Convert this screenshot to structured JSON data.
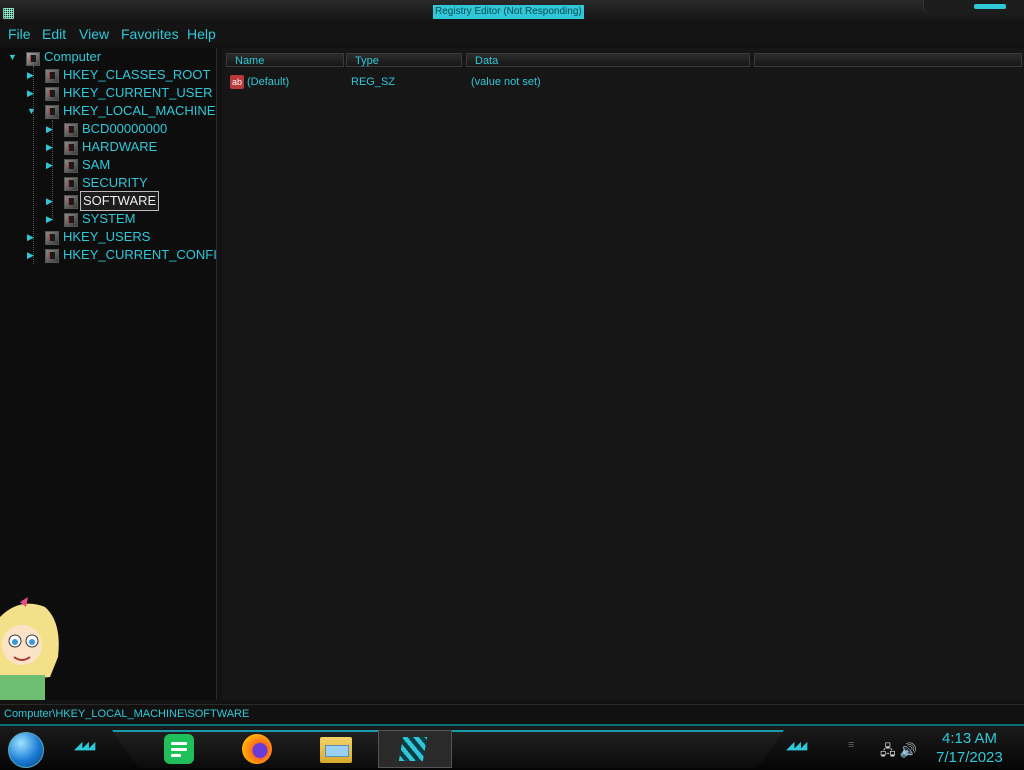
{
  "window": {
    "title": "Registry Editor (Not Responding)"
  },
  "menu": [
    "File",
    "Edit",
    "View",
    "Favorites",
    "Help"
  ],
  "tree": {
    "root": "Computer",
    "hives": [
      "HKEY_CLASSES_ROOT",
      "HKEY_CURRENT_USER",
      "HKEY_LOCAL_MACHINE",
      "HKEY_USERS",
      "HKEY_CURRENT_CONFI"
    ],
    "local_machine_children": [
      "BCD00000000",
      "HARDWARE",
      "SAM",
      "SECURITY",
      "SOFTWARE",
      "SYSTEM"
    ],
    "selected": "SOFTWARE"
  },
  "list": {
    "columns": [
      "Name",
      "Type",
      "Data"
    ],
    "rows": [
      {
        "icon": "ab",
        "name": "(Default)",
        "type": "REG_SZ",
        "data": "(value not set)"
      }
    ]
  },
  "status": {
    "path": "Computer\\HKEY_LOCAL_MACHINE\\SOFTWARE"
  },
  "taskbar": {
    "apps": [
      "notes-app-icon",
      "firefox-icon",
      "file-explorer-icon",
      "registry-editor-icon"
    ],
    "time": "4:13 AM",
    "date": "7/17/2023"
  },
  "theme": {
    "accent": "#2fc8d8",
    "background": "#161616"
  }
}
